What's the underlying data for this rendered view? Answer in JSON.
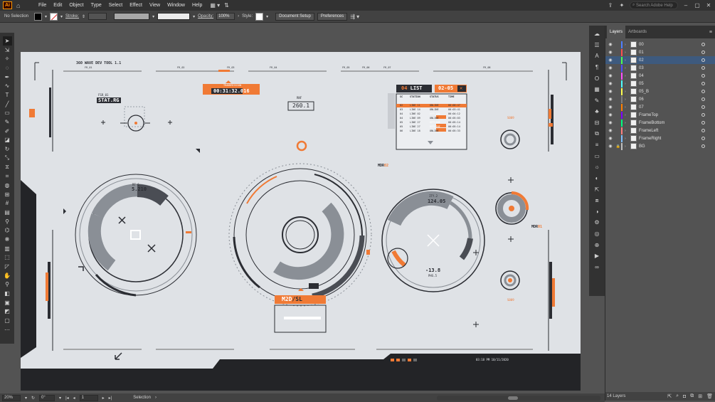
{
  "menubar": {
    "items": [
      "File",
      "Edit",
      "Object",
      "Type",
      "Select",
      "Effect",
      "View",
      "Window",
      "Help"
    ],
    "search_placeholder": "Search Adobe Help"
  },
  "control_bar": {
    "selection_state": "No Selection",
    "stroke_label": "Stroke:",
    "opacity_label": "Opacity:",
    "opacity_value": "100%",
    "style_label": "Style:",
    "document_setup": "Document Setup",
    "preferences": "Preferences"
  },
  "layers_panel": {
    "tabs": [
      "Layers",
      "Artboards"
    ],
    "layers": [
      {
        "name": "00",
        "color": "#4f7fff"
      },
      {
        "name": "01",
        "color": "#ff4f4f"
      },
      {
        "name": "02",
        "color": "#4fff4f",
        "selected": true
      },
      {
        "name": "03",
        "color": "#4f4fff"
      },
      {
        "name": "04",
        "color": "#ff4fff"
      },
      {
        "name": "05",
        "color": "#4fffff"
      },
      {
        "name": "05_B",
        "color": "#ffff4f"
      },
      {
        "name": "06",
        "color": "#7f7f7f"
      },
      {
        "name": "07",
        "color": "#ff7f00"
      },
      {
        "name": "FrameTop",
        "color": "#7f00ff"
      },
      {
        "name": "FrameBottom",
        "color": "#00ff7f"
      },
      {
        "name": "FrameLeft",
        "color": "#ff7f7f"
      },
      {
        "name": "FrameRight",
        "color": "#7fbfff"
      },
      {
        "name": "BG",
        "color": "#bfbfbf"
      }
    ],
    "footer_count": "14 Layers"
  },
  "status_bar": {
    "zoom": "20%",
    "rotation": "0°",
    "artboard_number": "1",
    "tool_name": "Selection"
  },
  "hud": {
    "title": "360 WAVE DEV TOOL 1.1",
    "stat_label": "STAT.RG",
    "ff_label": "FSR_01",
    "timecode": "00:31:32.016",
    "timecode_label": "TRANSMISSION",
    "main_value": "260.1",
    "main_label": "RNF",
    "left_value": "5.210",
    "left_value_label": "RF-6",
    "right_value": "124.05",
    "right_value_label": "ITY.2",
    "bottom_value": "-13.8",
    "bottom_value_label": "PHS.5",
    "mdr_left": "MDR",
    "mdr_left_num": "02",
    "mdr_right": "MDR",
    "mdr_right_num": "01",
    "m2d": "M2D",
    "m2d_sub": "/SL",
    "list_title": "LIST",
    "list_num": "04",
    "date_badge": "02-05",
    "table_headers": [
      "SC",
      "STATION",
      "STATUS",
      "TIME"
    ],
    "table_rows": [
      [
        "02",
        "LINE 11",
        "ONLINE",
        "00:00:47"
      ],
      [
        "03",
        "LINE 14",
        "ONLINE",
        "00:03:41"
      ],
      [
        "04",
        "LINE 02",
        "OFFLINE",
        "00:04:12"
      ],
      [
        "04",
        "LINE 09",
        "ONLINE",
        "00:05:03"
      ],
      [
        "05",
        "LINE 27",
        "OFFLINE",
        "00:05:14"
      ],
      [
        "05",
        "LINE 27",
        "OFFLINE",
        "00:05:14"
      ],
      [
        "06",
        "LINE 18",
        "ONLINE",
        "00:05:33"
      ]
    ],
    "s009_top": "S009",
    "s009_bottom": "S009",
    "footer_time": "03:18 PM 10/11/2020",
    "ruler_tags": [
      "FR_01",
      "FR_02",
      "FR_03",
      "FR_04",
      "FR_05",
      "FR_06",
      "FR_07",
      "FR_08"
    ]
  },
  "colors": {
    "accent": "#f07a35",
    "dark": "#2b2d33",
    "panel_bg": "#535353",
    "artboard_bg": "#dfe2e6",
    "selected_row": "#3e5a7e"
  }
}
